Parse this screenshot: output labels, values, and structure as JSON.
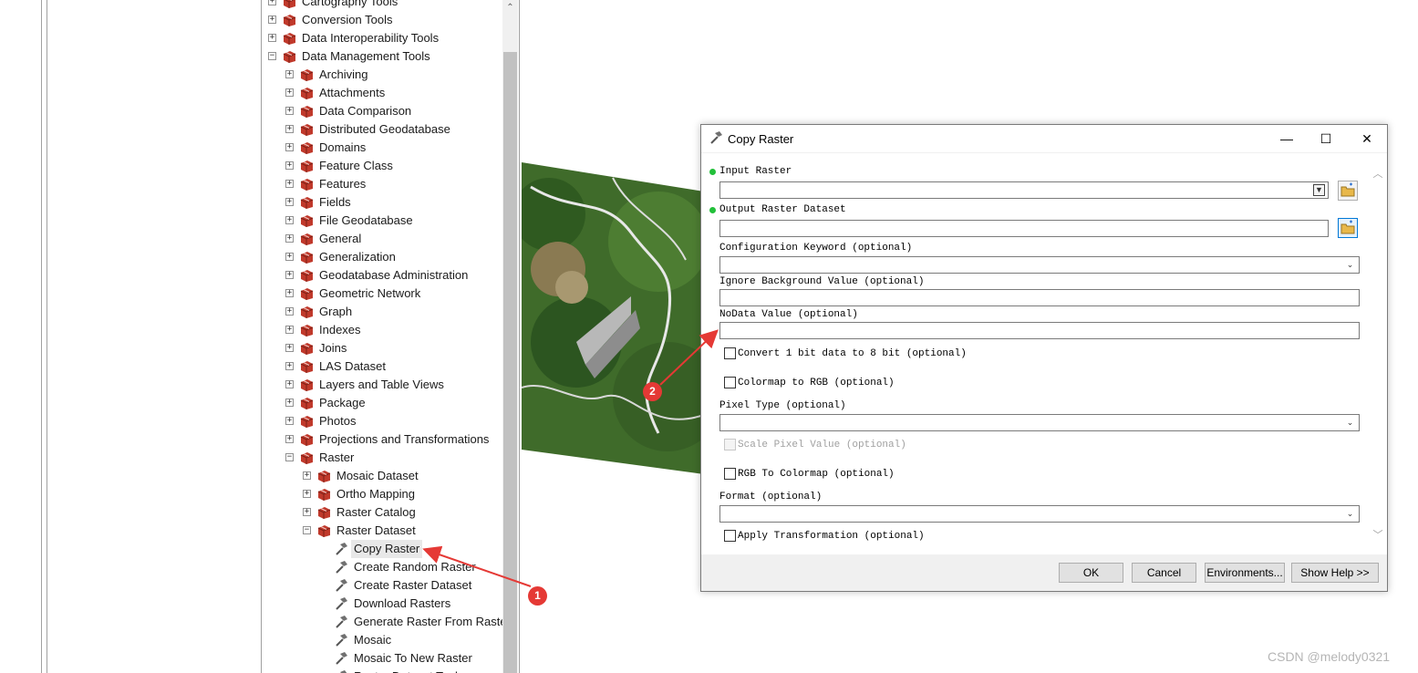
{
  "tree": {
    "items": [
      {
        "label": "Cartography Tools",
        "level": 0,
        "kind": "toolbox",
        "state": "collapsed"
      },
      {
        "label": "Conversion Tools",
        "level": 0,
        "kind": "toolbox",
        "state": "collapsed"
      },
      {
        "label": "Data Interoperability Tools",
        "level": 0,
        "kind": "toolbox",
        "state": "collapsed"
      },
      {
        "label": "Data Management Tools",
        "level": 0,
        "kind": "toolbox",
        "state": "expanded"
      },
      {
        "label": "Archiving",
        "level": 1,
        "kind": "toolset",
        "state": "collapsed"
      },
      {
        "label": "Attachments",
        "level": 1,
        "kind": "toolset",
        "state": "collapsed"
      },
      {
        "label": "Data Comparison",
        "level": 1,
        "kind": "toolset",
        "state": "collapsed"
      },
      {
        "label": "Distributed Geodatabase",
        "level": 1,
        "kind": "toolset",
        "state": "collapsed"
      },
      {
        "label": "Domains",
        "level": 1,
        "kind": "toolset",
        "state": "collapsed"
      },
      {
        "label": "Feature Class",
        "level": 1,
        "kind": "toolset",
        "state": "collapsed"
      },
      {
        "label": "Features",
        "level": 1,
        "kind": "toolset",
        "state": "collapsed"
      },
      {
        "label": "Fields",
        "level": 1,
        "kind": "toolset",
        "state": "collapsed"
      },
      {
        "label": "File Geodatabase",
        "level": 1,
        "kind": "toolset",
        "state": "collapsed"
      },
      {
        "label": "General",
        "level": 1,
        "kind": "toolset",
        "state": "collapsed"
      },
      {
        "label": "Generalization",
        "level": 1,
        "kind": "toolset",
        "state": "collapsed"
      },
      {
        "label": "Geodatabase Administration",
        "level": 1,
        "kind": "toolset",
        "state": "collapsed"
      },
      {
        "label": "Geometric Network",
        "level": 1,
        "kind": "toolset",
        "state": "collapsed"
      },
      {
        "label": "Graph",
        "level": 1,
        "kind": "toolset",
        "state": "collapsed"
      },
      {
        "label": "Indexes",
        "level": 1,
        "kind": "toolset",
        "state": "collapsed"
      },
      {
        "label": "Joins",
        "level": 1,
        "kind": "toolset",
        "state": "collapsed"
      },
      {
        "label": "LAS Dataset",
        "level": 1,
        "kind": "toolset",
        "state": "collapsed"
      },
      {
        "label": "Layers and Table Views",
        "level": 1,
        "kind": "toolset",
        "state": "collapsed"
      },
      {
        "label": "Package",
        "level": 1,
        "kind": "toolset",
        "state": "collapsed"
      },
      {
        "label": "Photos",
        "level": 1,
        "kind": "toolset",
        "state": "collapsed"
      },
      {
        "label": "Projections and Transformations",
        "level": 1,
        "kind": "toolset",
        "state": "collapsed"
      },
      {
        "label": "Raster",
        "level": 1,
        "kind": "toolset",
        "state": "expanded"
      },
      {
        "label": "Mosaic Dataset",
        "level": 2,
        "kind": "toolset",
        "state": "collapsed"
      },
      {
        "label": "Ortho Mapping",
        "level": 2,
        "kind": "toolset",
        "state": "collapsed"
      },
      {
        "label": "Raster Catalog",
        "level": 2,
        "kind": "toolset",
        "state": "collapsed"
      },
      {
        "label": "Raster Dataset",
        "level": 2,
        "kind": "toolset",
        "state": "expanded"
      },
      {
        "label": "Copy Raster",
        "level": 3,
        "kind": "tool",
        "state": "selected"
      },
      {
        "label": "Create Random Raster",
        "level": 3,
        "kind": "tool",
        "state": ""
      },
      {
        "label": "Create Raster Dataset",
        "level": 3,
        "kind": "tool",
        "state": ""
      },
      {
        "label": "Download Rasters",
        "level": 3,
        "kind": "tool",
        "state": ""
      },
      {
        "label": "Generate Raster From Raster Function",
        "level": 3,
        "kind": "tool",
        "state": ""
      },
      {
        "label": "Mosaic",
        "level": 3,
        "kind": "tool",
        "state": ""
      },
      {
        "label": "Mosaic To New Raster",
        "level": 3,
        "kind": "tool",
        "state": ""
      },
      {
        "label": "Raster Dataset Tool",
        "level": 3,
        "kind": "tool",
        "state": ""
      }
    ]
  },
  "dialog": {
    "title": "Copy Raster",
    "window_buttons": {
      "minimize": "—",
      "maximize": "☐",
      "close": "✕"
    },
    "params": {
      "input_raster": {
        "label": "Input Raster",
        "value": "",
        "required": true
      },
      "output_raster": {
        "label": "Output Raster Dataset",
        "value": "",
        "required": true
      },
      "config_keyword": {
        "label": "Configuration Keyword (optional)",
        "value": ""
      },
      "ignore_background": {
        "label": "Ignore Background Value (optional)",
        "value": ""
      },
      "nodata": {
        "label": "NoData Value (optional)",
        "value": ""
      },
      "convert_1bit": {
        "label": "Convert 1 bit data to 8 bit (optional)",
        "checked": false
      },
      "colormap_rgb": {
        "label": "Colormap to RGB (optional)",
        "checked": false
      },
      "pixel_type": {
        "label": "Pixel Type (optional)",
        "value": ""
      },
      "scale_pixel": {
        "label": "Scale Pixel Value (optional)",
        "checked": false,
        "enabled": false
      },
      "rgb_colormap": {
        "label": "RGB To Colormap (optional)",
        "checked": false
      },
      "format": {
        "label": "Format (optional)",
        "value": ""
      },
      "apply_transform": {
        "label": "Apply Transformation (optional)",
        "checked": false
      }
    },
    "buttons": {
      "ok": "OK",
      "cancel": "Cancel",
      "environments": "Environments...",
      "show_help": "Show Help >>"
    }
  },
  "annotations": {
    "badge1": "1",
    "badge2": "2",
    "arrow_color": "#e53935"
  },
  "watermark": "CSDN @melody0321",
  "colors": {
    "required_dot": "#22c03a",
    "toolbox_red": "#c0392b",
    "focus_blue": "#0078d7"
  }
}
